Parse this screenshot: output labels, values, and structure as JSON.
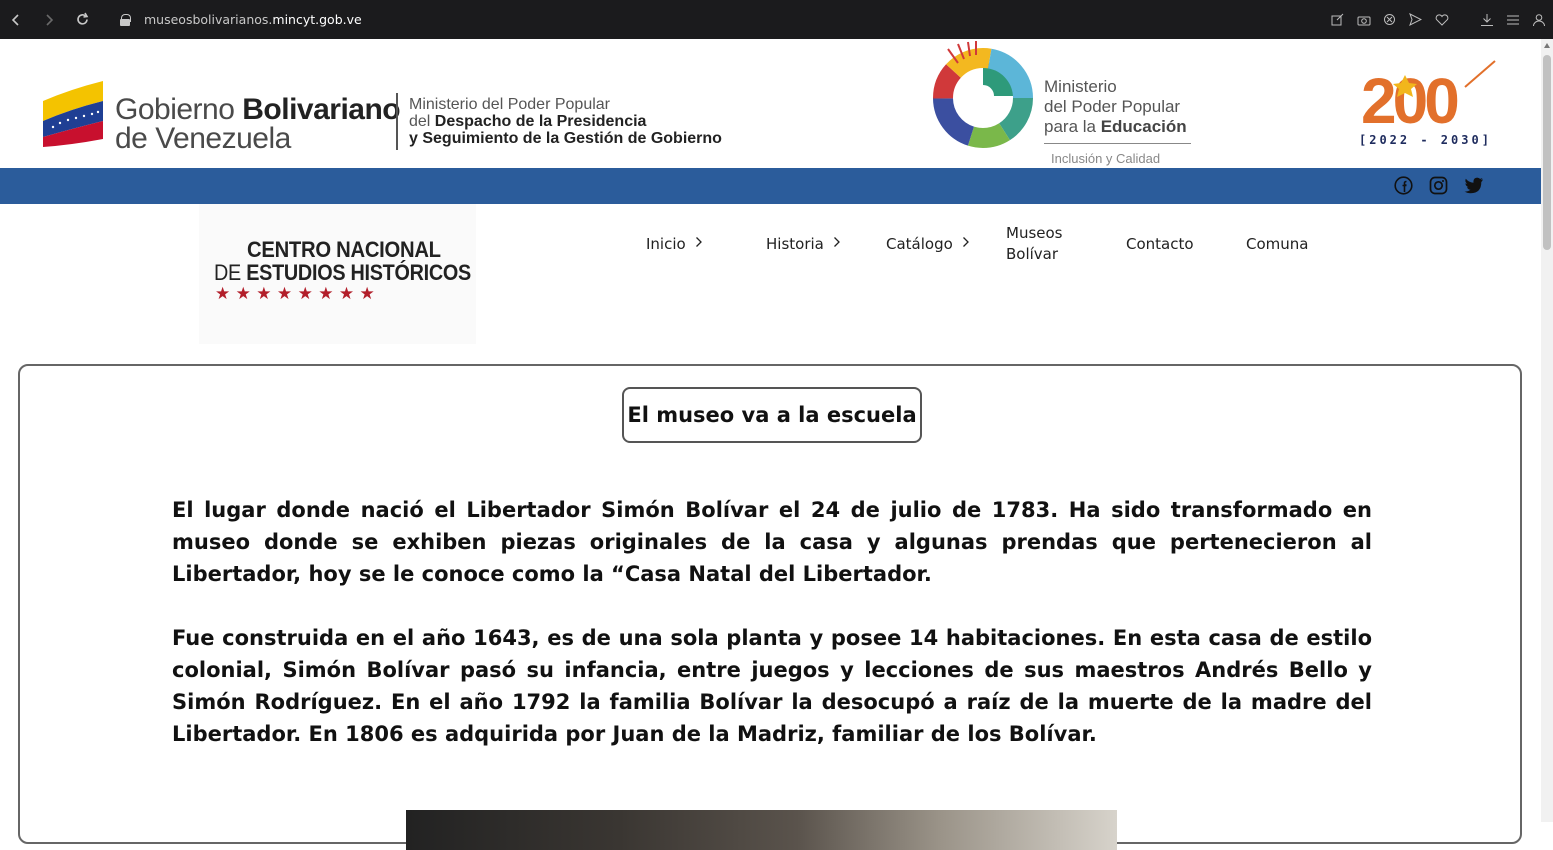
{
  "browser": {
    "url_prefix": "museosbolivarianos.",
    "url_domain": "mincyt.gob.ve"
  },
  "header": {
    "gob_line1_light": "Gobierno ",
    "gob_line1_bold": "Bolivariano",
    "gob_line2": "de Venezuela",
    "min_line1": "Ministerio del Poder Popular",
    "min_line2_light": "del ",
    "min_line2_bold": "Despacho de la Presidencia",
    "min_line3": "y Seguimiento de la Gestión de Gobierno",
    "edu_line1": "Ministerio",
    "edu_line2": "del Poder Popular",
    "edu_line3_light": "para la ",
    "edu_line3_bold": "Educación",
    "edu_sub": "Inclusión y Calidad",
    "logo200_main": "200",
    "logo200_years": "[2022 - 2030]"
  },
  "site": {
    "cneh_line1": "CENTRO NACIONAL",
    "cneh_line2_light": "DE ",
    "cneh_line2_bold": "ESTUDIOS HISTÓRICOS",
    "stars": "★ ★ ★ ★ ★ ★ ★ ★"
  },
  "menu": {
    "inicio": "Inicio",
    "historia": "Historia",
    "catalogo": "Catálogo",
    "museos_line1": "Museos",
    "museos_line2": "Bolívar",
    "contacto": "Contacto",
    "comuna": "Comuna"
  },
  "content": {
    "heading": "El museo va a la escuela",
    "para1": "El lugar donde nació el Libertador Simón Bolívar el 24 de julio de 1783. Ha sido transformado en museo donde se exhiben piezas originales de la casa y algunas prendas que pertenecieron al Libertador, hoy se le conoce como la “Casa Natal del Libertador.",
    "para2": "Fue construida en el año 1643, es de una sola planta y posee 14 habitaciones. En esta casa de estilo colonial, Simón Bolívar pasó su infancia, entre juegos y lecciones de sus maestros Andrés Bello y Simón Rodríguez. En el año 1792 la familia Bolívar la desocupó a raíz de la muerte de la madre del Libertador. En 1806 es adquirida por Juan de la Madriz, familiar de los Bolívar."
  },
  "colors": {
    "bluebar": "#2b5c9b",
    "star_red": "#b21e2a"
  }
}
